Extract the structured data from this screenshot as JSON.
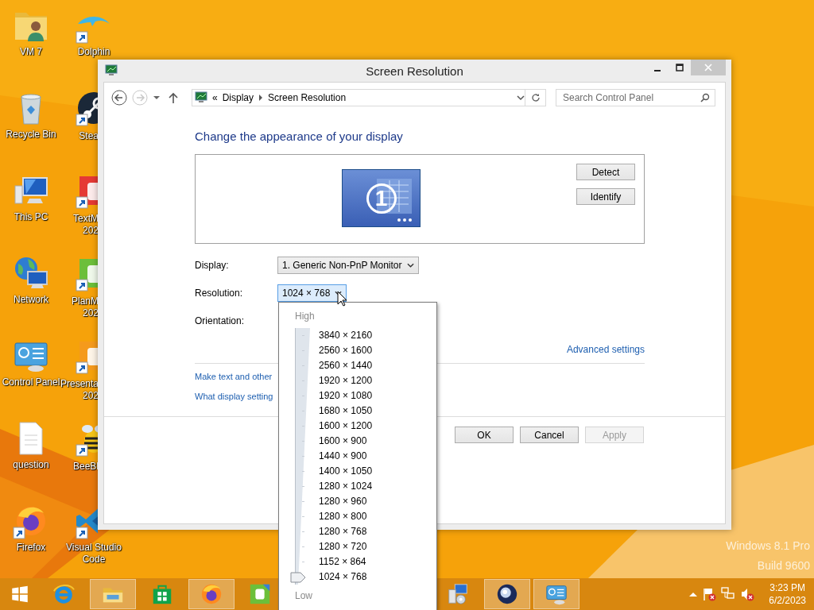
{
  "desktop_icons": [
    {
      "lines": [
        "VM 7"
      ],
      "kind": "full"
    },
    {
      "lines": [
        "Recycle Bin"
      ],
      "kind": "full"
    },
    {
      "lines": [
        "This PC"
      ],
      "kind": "full"
    },
    {
      "lines": [
        "Network"
      ],
      "kind": "full"
    },
    {
      "lines": [
        "Control Panel"
      ],
      "kind": "full"
    },
    {
      "lines": [
        "question"
      ],
      "kind": "full"
    },
    {
      "lines": [
        "Firefox"
      ],
      "kind": "full"
    },
    {
      "lines": [
        "Dolphin"
      ],
      "kind": "full"
    },
    {
      "lines": [
        "Stea"
      ],
      "kind": "cut"
    },
    {
      "lines": [
        "TextM",
        "202"
      ],
      "kind": "cut"
    },
    {
      "lines": [
        "PlanM",
        "202"
      ],
      "kind": "cut"
    },
    {
      "lines": [
        "Presenta",
        "202"
      ],
      "kind": "cut"
    },
    {
      "lines": [
        "BeeBl"
      ],
      "kind": "cut"
    },
    {
      "lines": [
        "Visual Studio",
        "Code"
      ],
      "kind": "full"
    }
  ],
  "window": {
    "title": "Screen Resolution"
  },
  "address_bar": {
    "overflow": "«",
    "path": [
      "Display",
      "Screen Resolution"
    ]
  },
  "search": {
    "placeholder": "Search Control Panel"
  },
  "heading": "Change the appearance of your display",
  "monitor_number": "1",
  "preview_buttons": [
    "Detect",
    "Identify"
  ],
  "settings": [
    {
      "label": "Display:",
      "kind": "select",
      "value": "1. Generic Non-PnP Monitor",
      "open": false
    },
    {
      "label": "Resolution:",
      "kind": "select",
      "value": "1024 × 768",
      "open": true
    },
    {
      "label": "Orientation:",
      "kind": "label-only"
    }
  ],
  "advanced_link": "Advanced settings",
  "links": [
    "Make text and other",
    "What display setting"
  ],
  "buttons": [
    {
      "label": "OK",
      "disabled": false
    },
    {
      "label": "Cancel",
      "disabled": false
    },
    {
      "label": "Apply",
      "disabled": true
    }
  ],
  "resolution_menu": {
    "top_label": "High",
    "bottom_label": "Low",
    "level": 0,
    "options": [
      "3840 × 2160",
      "2560 × 1600",
      "2560 × 1440",
      "1920 × 1200",
      "1920 × 1080",
      "1680 × 1050",
      "1600 × 1200",
      "1600 × 900",
      "1440 × 900",
      "1400 × 1050",
      "1280 × 1024",
      "1280 × 960",
      "1280 × 800",
      "1280 × 768",
      "1280 × 720",
      "1152 × 864",
      "1024 × 768"
    ]
  },
  "watermark": [
    "Windows 8.1 Pro",
    "Build 9600"
  ],
  "taskbar": {
    "items": [
      {
        "active": false
      },
      {
        "active": true
      },
      {
        "active": false
      },
      {
        "active": true
      },
      {
        "active": false
      },
      {
        "active": false
      },
      {
        "active": true
      },
      {
        "active": true
      }
    ]
  },
  "clock": {
    "time": "3:23 PM",
    "date": "6/2/2023"
  }
}
